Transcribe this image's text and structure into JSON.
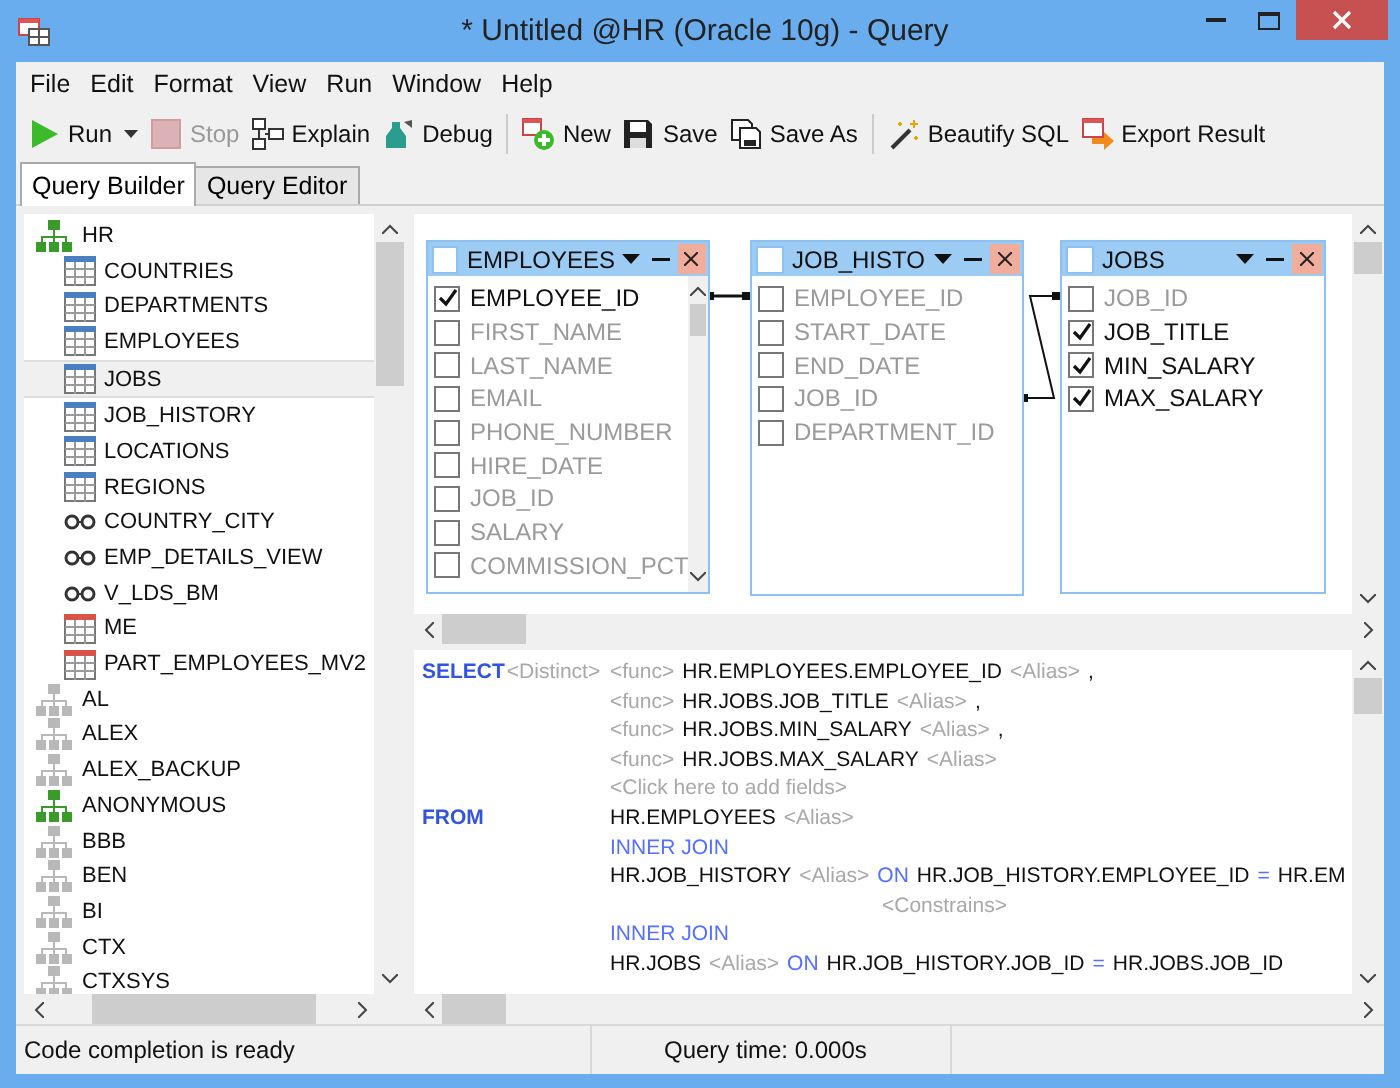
{
  "window": {
    "title": "* Untitled @HR (Oracle 10g) - Query"
  },
  "menu": [
    "File",
    "Edit",
    "Format",
    "View",
    "Run",
    "Window",
    "Help"
  ],
  "toolbar": [
    {
      "label": "Run",
      "disabled": false,
      "dropdown": true
    },
    {
      "label": "Stop",
      "disabled": true,
      "dropdown": false
    },
    {
      "label": "Explain",
      "disabled": false,
      "dropdown": false
    },
    {
      "label": "Debug",
      "disabled": false,
      "dropdown": false
    },
    {
      "label": "New",
      "disabled": false,
      "dropdown": false
    },
    {
      "label": "Save",
      "disabled": false,
      "dropdown": false
    },
    {
      "label": "Save As",
      "disabled": false,
      "dropdown": false
    },
    {
      "label": "Beautify SQL",
      "disabled": false,
      "dropdown": false
    },
    {
      "label": "Export Result",
      "disabled": false,
      "dropdown": false
    }
  ],
  "tabs": [
    {
      "label": "Query Builder",
      "selected": true
    },
    {
      "label": "Query Editor",
      "selected": false
    }
  ],
  "tree": [
    {
      "label": "HR",
      "kind": "schema",
      "connected": true,
      "selected": false,
      "children": [
        {
          "label": "COUNTRIES",
          "kind": "table",
          "selected": false
        },
        {
          "label": "DEPARTMENTS",
          "kind": "table",
          "selected": false
        },
        {
          "label": "EMPLOYEES",
          "kind": "table",
          "selected": false
        },
        {
          "label": "JOBS",
          "kind": "table",
          "selected": true
        },
        {
          "label": "JOB_HISTORY",
          "kind": "table",
          "selected": false
        },
        {
          "label": "LOCATIONS",
          "kind": "table",
          "selected": false
        },
        {
          "label": "REGIONS",
          "kind": "table",
          "selected": false
        },
        {
          "label": "COUNTRY_CITY",
          "kind": "view",
          "selected": false
        },
        {
          "label": "EMP_DETAILS_VIEW",
          "kind": "view",
          "selected": false
        },
        {
          "label": "V_LDS_BM",
          "kind": "view",
          "selected": false
        },
        {
          "label": "ME",
          "kind": "mview",
          "selected": false
        },
        {
          "label": "PART_EMPLOYEES_MV2",
          "kind": "mview",
          "selected": false
        }
      ]
    },
    {
      "label": "AL",
      "kind": "schema",
      "connected": false,
      "selected": false
    },
    {
      "label": "ALEX",
      "kind": "schema",
      "connected": false,
      "selected": false
    },
    {
      "label": "ALEX_BACKUP",
      "kind": "schema",
      "connected": false,
      "selected": false
    },
    {
      "label": "ANONYMOUS",
      "kind": "schema",
      "connected": true,
      "selected": false
    },
    {
      "label": "BBB",
      "kind": "schema",
      "connected": false,
      "selected": false
    },
    {
      "label": "BEN",
      "kind": "schema",
      "connected": false,
      "selected": false
    },
    {
      "label": "BI",
      "kind": "schema",
      "connected": false,
      "selected": false
    },
    {
      "label": "CTX",
      "kind": "schema",
      "connected": false,
      "selected": false
    },
    {
      "label": "CTXSYS",
      "kind": "schema",
      "connected": false,
      "selected": false
    }
  ],
  "diagram": {
    "tables": [
      {
        "title": "EMPLOYEES",
        "all_checked": false,
        "scrollable": true,
        "fields": [
          {
            "name": "EMPLOYEE_ID",
            "checked": true
          },
          {
            "name": "FIRST_NAME",
            "checked": false
          },
          {
            "name": "LAST_NAME",
            "checked": false
          },
          {
            "name": "EMAIL",
            "checked": false
          },
          {
            "name": "PHONE_NUMBER",
            "checked": false
          },
          {
            "name": "HIRE_DATE",
            "checked": false
          },
          {
            "name": "JOB_ID",
            "checked": false
          },
          {
            "name": "SALARY",
            "checked": false
          },
          {
            "name": "COMMISSION_PCT",
            "checked": false
          }
        ]
      },
      {
        "title": "JOB_HISTO",
        "all_checked": false,
        "scrollable": false,
        "fields": [
          {
            "name": "EMPLOYEE_ID",
            "checked": false
          },
          {
            "name": "START_DATE",
            "checked": false
          },
          {
            "name": "END_DATE",
            "checked": false
          },
          {
            "name": "JOB_ID",
            "checked": false
          },
          {
            "name": "DEPARTMENT_ID",
            "checked": false
          }
        ]
      },
      {
        "title": "JOBS",
        "all_checked": false,
        "scrollable": false,
        "fields": [
          {
            "name": "JOB_ID",
            "checked": false
          },
          {
            "name": "JOB_TITLE",
            "checked": true
          },
          {
            "name": "MIN_SALARY",
            "checked": true
          },
          {
            "name": "MAX_SALARY",
            "checked": true
          }
        ]
      }
    ]
  },
  "sql": {
    "lines": [
      {
        "kind": "clause",
        "lead": [
          {
            "text": "SELECT",
            "kind": "keyword"
          },
          {
            "text": "<Distinct>",
            "kind": "hint"
          }
        ],
        "tokens": [
          {
            "text": "<func>",
            "kind": "hint"
          },
          {
            "text": "HR.EMPLOYEES.EMPLOYEE_ID",
            "kind": "ident"
          },
          {
            "text": "<Alias>",
            "kind": "hint"
          },
          {
            "text": ",",
            "kind": "ident"
          }
        ]
      },
      {
        "kind": "item",
        "tokens": [
          {
            "text": "<func>",
            "kind": "hint"
          },
          {
            "text": "HR.JOBS.JOB_TITLE",
            "kind": "ident"
          },
          {
            "text": "<Alias>",
            "kind": "hint"
          },
          {
            "text": ",",
            "kind": "ident"
          }
        ]
      },
      {
        "kind": "item",
        "tokens": [
          {
            "text": "<func>",
            "kind": "hint"
          },
          {
            "text": "HR.JOBS.MIN_SALARY",
            "kind": "ident"
          },
          {
            "text": "<Alias>",
            "kind": "hint"
          },
          {
            "text": ",",
            "kind": "ident"
          }
        ]
      },
      {
        "kind": "item",
        "tokens": [
          {
            "text": "<func>",
            "kind": "hint"
          },
          {
            "text": "HR.JOBS.MAX_SALARY",
            "kind": "ident"
          },
          {
            "text": "<Alias>",
            "kind": "hint"
          }
        ]
      },
      {
        "kind": "item",
        "tokens": [
          {
            "text": "<Click here to add fields>",
            "kind": "hint"
          }
        ]
      },
      {
        "kind": "clause",
        "lead": [
          {
            "text": "FROM",
            "kind": "keyword"
          }
        ],
        "tokens": [
          {
            "text": "HR.EMPLOYEES",
            "kind": "ident"
          },
          {
            "text": "<Alias>",
            "kind": "hint"
          }
        ]
      },
      {
        "kind": "item",
        "tokens": [
          {
            "text": "INNER JOIN",
            "kind": "join"
          }
        ]
      },
      {
        "kind": "item",
        "tokens": [
          {
            "text": "HR.JOB_HISTORY",
            "kind": "ident"
          },
          {
            "text": "<Alias>",
            "kind": "hint"
          },
          {
            "text": "ON",
            "kind": "join"
          },
          {
            "text": "HR.JOB_HISTORY.EMPLOYEE_ID",
            "kind": "ident"
          },
          {
            "text": "=",
            "kind": "join"
          },
          {
            "text": "HR.EM",
            "kind": "ident"
          }
        ]
      },
      {
        "kind": "sub",
        "tokens": [
          {
            "text": "<Constrains>",
            "kind": "hint"
          }
        ]
      },
      {
        "kind": "item",
        "tokens": [
          {
            "text": "INNER JOIN",
            "kind": "join"
          }
        ]
      },
      {
        "kind": "item",
        "tokens": [
          {
            "text": "HR.JOBS",
            "kind": "ident"
          },
          {
            "text": "<Alias>",
            "kind": "hint"
          },
          {
            "text": "ON",
            "kind": "join"
          },
          {
            "text": "HR.JOB_HISTORY.JOB_ID",
            "kind": "ident"
          },
          {
            "text": "=",
            "kind": "join"
          },
          {
            "text": "HR.JOBS.JOB_ID",
            "kind": "ident"
          }
        ]
      }
    ]
  },
  "status_bar": [
    "Code completion is ready",
    "Query time: 0.000s"
  ]
}
